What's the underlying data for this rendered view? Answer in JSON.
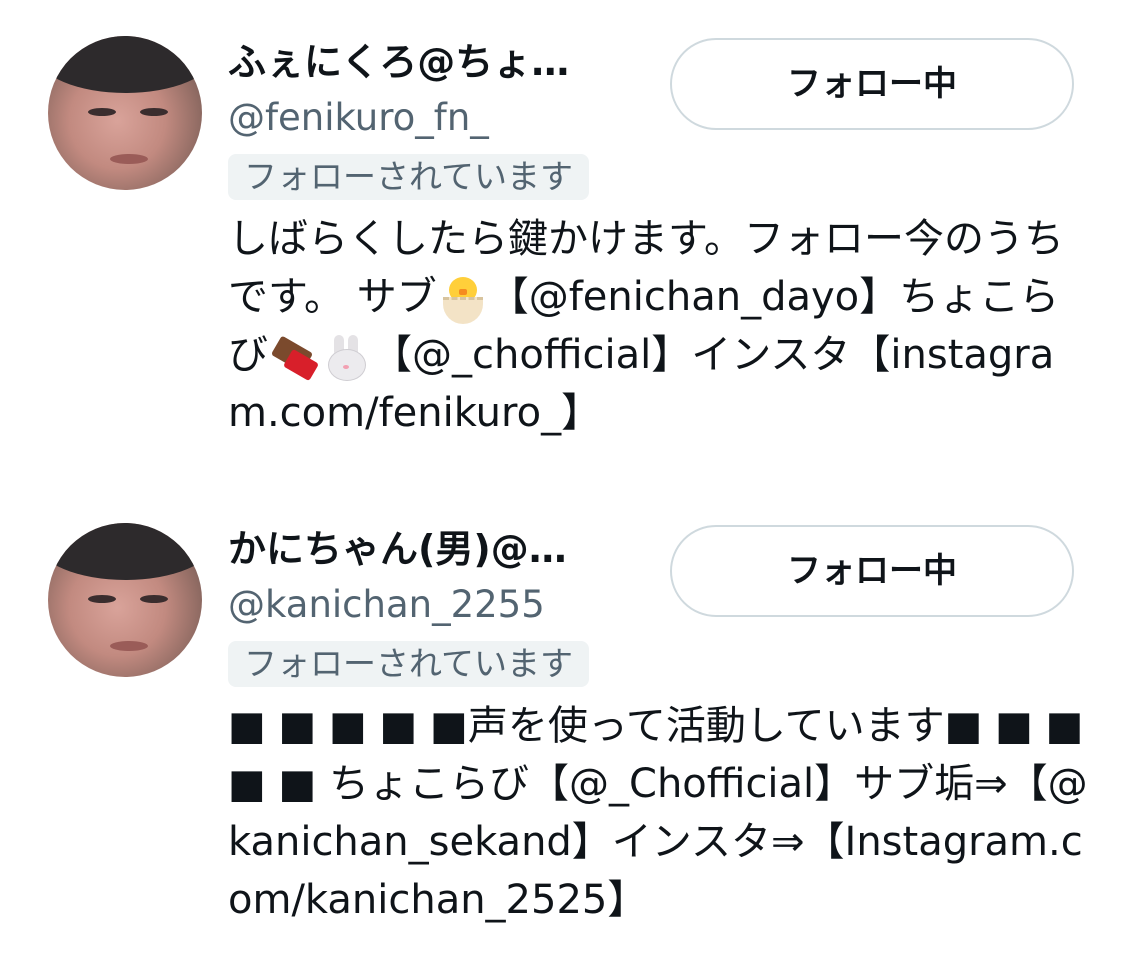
{
  "users": [
    {
      "display_name": "ふぇにくろ@ちょ…",
      "handle": "@fenikuro_fn_",
      "follows_you_label": "フォローされています",
      "follow_button_label": "フォロー中",
      "bio": {
        "part1": "しばらくしたら鍵かけます。フォロー今のうちです。 サブ",
        "emoji1": "hatching-chick-emoji",
        "part2": "【@fenichan_dayo】ちょこらび",
        "emoji2": "chocolate-bar-emoji",
        "emoji3": "rabbit-face-emoji",
        "part3": "【@_chofficial】インスタ【instagram.com/fenikuro_】"
      }
    },
    {
      "display_name": "かにちゃん(男)@…",
      "handle": "@kanichan_2255",
      "follows_you_label": "フォローされています",
      "follow_button_label": "フォロー中",
      "bio": {
        "text": "■ ■ ■ ■ ■声を使って活動しています■ ■ ■ ■ ■ ちょこらび【@_Chofficial】サブ垢⇒【@kanichan_sekand】インスタ⇒【Instagram.com/kanichan_2525】"
      }
    }
  ],
  "colors": {
    "text_primary": "#0f1419",
    "text_secondary": "#536471",
    "badge_bg": "#eff3f4",
    "button_border": "#cfd9de"
  }
}
